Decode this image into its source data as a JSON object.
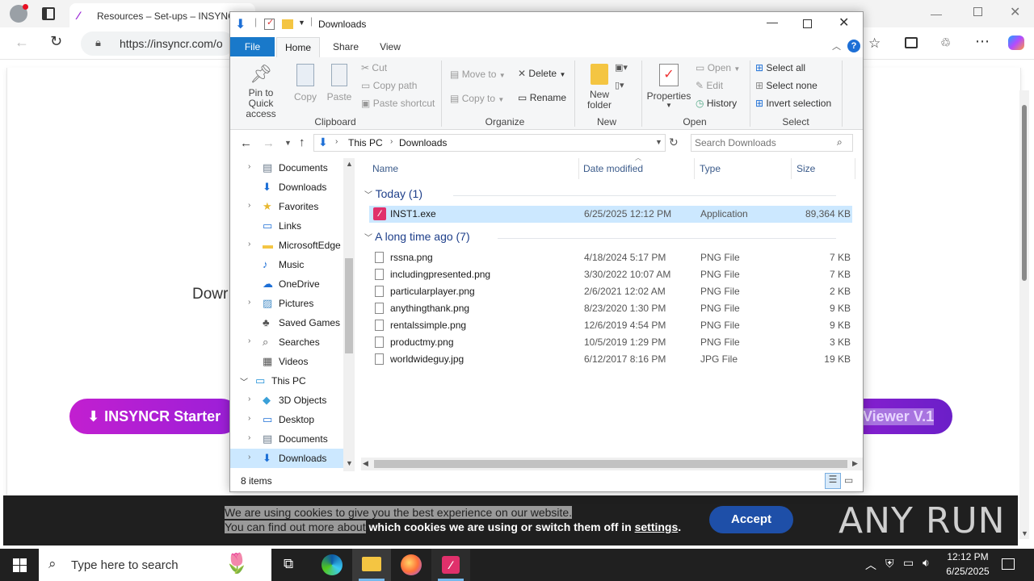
{
  "browser": {
    "tab_title": "Resources – Set-ups – INSYNCR",
    "url": "https://insyncr.com/o"
  },
  "page": {
    "partial_text": "Dowr",
    "download_starter": "INSYNCR Starter",
    "download_viewer": "Viewer V.1",
    "cookie_line1": "We are using cookies to give you the best experience on our website.",
    "cookie_line2_a": "You can find out more about",
    "cookie_line2_b": " which cookies we are using or switch them off in ",
    "cookie_settings": "settings",
    "cookie_period": ".",
    "accept_label": "Accept",
    "watermark": "ANY RUN"
  },
  "explorer": {
    "title": "Downloads",
    "tabs": [
      "File",
      "Home",
      "Share",
      "View"
    ],
    "ribbon": {
      "pin": "Pin to Quick",
      "pin2": "access",
      "copy": "Copy",
      "paste": "Paste",
      "cut": "Cut",
      "copy_path": "Copy path",
      "paste_shortcut": "Paste shortcut",
      "clipboard": "Clipboard",
      "move_to": "Move to",
      "copy_to": "Copy to",
      "delete": "Delete",
      "rename": "Rename",
      "organize": "Organize",
      "new_folder": "New",
      "new_folder2": "folder",
      "new": "New",
      "properties": "Properties",
      "open": "Open",
      "edit": "Edit",
      "history": "History",
      "open_group": "Open",
      "select_all": "Select all",
      "select_none": "Select none",
      "invert_selection": "Invert selection",
      "select": "Select"
    },
    "breadcrumb": [
      "This PC",
      "Downloads"
    ],
    "search_placeholder": "Search Downloads",
    "tree": [
      {
        "label": "Documents",
        "icon": "document-icon",
        "indent": 1,
        "expander": true
      },
      {
        "label": "Downloads",
        "icon": "download-icon",
        "indent": 1,
        "expander": false
      },
      {
        "label": "Favorites",
        "icon": "star-icon",
        "indent": 1,
        "expander": true
      },
      {
        "label": "Links",
        "icon": "link-icon",
        "indent": 1,
        "expander": false
      },
      {
        "label": "MicrosoftEdge",
        "icon": "folder-icon",
        "indent": 1,
        "expander": true
      },
      {
        "label": "Music",
        "icon": "music-icon",
        "indent": 1,
        "expander": false
      },
      {
        "label": "OneDrive",
        "icon": "cloud-icon",
        "indent": 1,
        "expander": false
      },
      {
        "label": "Pictures",
        "icon": "pictures-icon",
        "indent": 1,
        "expander": true
      },
      {
        "label": "Saved Games",
        "icon": "games-icon",
        "indent": 1,
        "expander": false
      },
      {
        "label": "Searches",
        "icon": "search-icon",
        "indent": 1,
        "expander": true
      },
      {
        "label": "Videos",
        "icon": "video-icon",
        "indent": 1,
        "expander": false
      },
      {
        "label": "This PC",
        "icon": "pc-icon",
        "indent": 0,
        "expander": "open"
      },
      {
        "label": "3D Objects",
        "icon": "cube-icon",
        "indent": 1,
        "expander": true
      },
      {
        "label": "Desktop",
        "icon": "desktop-icon",
        "indent": 1,
        "expander": true
      },
      {
        "label": "Documents",
        "icon": "document-icon",
        "indent": 1,
        "expander": true
      },
      {
        "label": "Downloads",
        "icon": "download-icon",
        "indent": 1,
        "expander": true,
        "selected": true
      }
    ],
    "columns": [
      "Name",
      "Date modified",
      "Type",
      "Size"
    ],
    "group_today": "Today (1)",
    "group_long": "A long time ago (7)",
    "today_files": [
      {
        "name": "INST1.exe",
        "date": "6/25/2025 12:12 PM",
        "type": "Application",
        "size": "89,364 KB"
      }
    ],
    "old_files": [
      {
        "name": "rssna.png",
        "date": "4/18/2024 5:17 PM",
        "type": "PNG File",
        "size": "7 KB"
      },
      {
        "name": "includingpresented.png",
        "date": "3/30/2022 10:07 AM",
        "type": "PNG File",
        "size": "7 KB"
      },
      {
        "name": "particularplayer.png",
        "date": "2/6/2021 12:02 AM",
        "type": "PNG File",
        "size": "2 KB"
      },
      {
        "name": "anythingthank.png",
        "date": "8/23/2020 1:30 PM",
        "type": "PNG File",
        "size": "9 KB"
      },
      {
        "name": "rentalssimple.png",
        "date": "12/6/2019 4:54 PM",
        "type": "PNG File",
        "size": "9 KB"
      },
      {
        "name": "productmy.png",
        "date": "10/5/2019 1:29 PM",
        "type": "PNG File",
        "size": "3 KB"
      },
      {
        "name": "worldwideguy.jpg",
        "date": "6/12/2017 8:16 PM",
        "type": "JPG File",
        "size": "19 KB"
      }
    ],
    "status": "8 items"
  },
  "taskbar": {
    "search_placeholder": "Type here to search",
    "time": "12:12 PM",
    "date": "6/25/2025"
  },
  "colors": {
    "accent": "#0078d4",
    "brand_gradient_start": "#c21fd0",
    "accept_button": "#1e4fa8",
    "selected_row": "#cce8ff"
  }
}
